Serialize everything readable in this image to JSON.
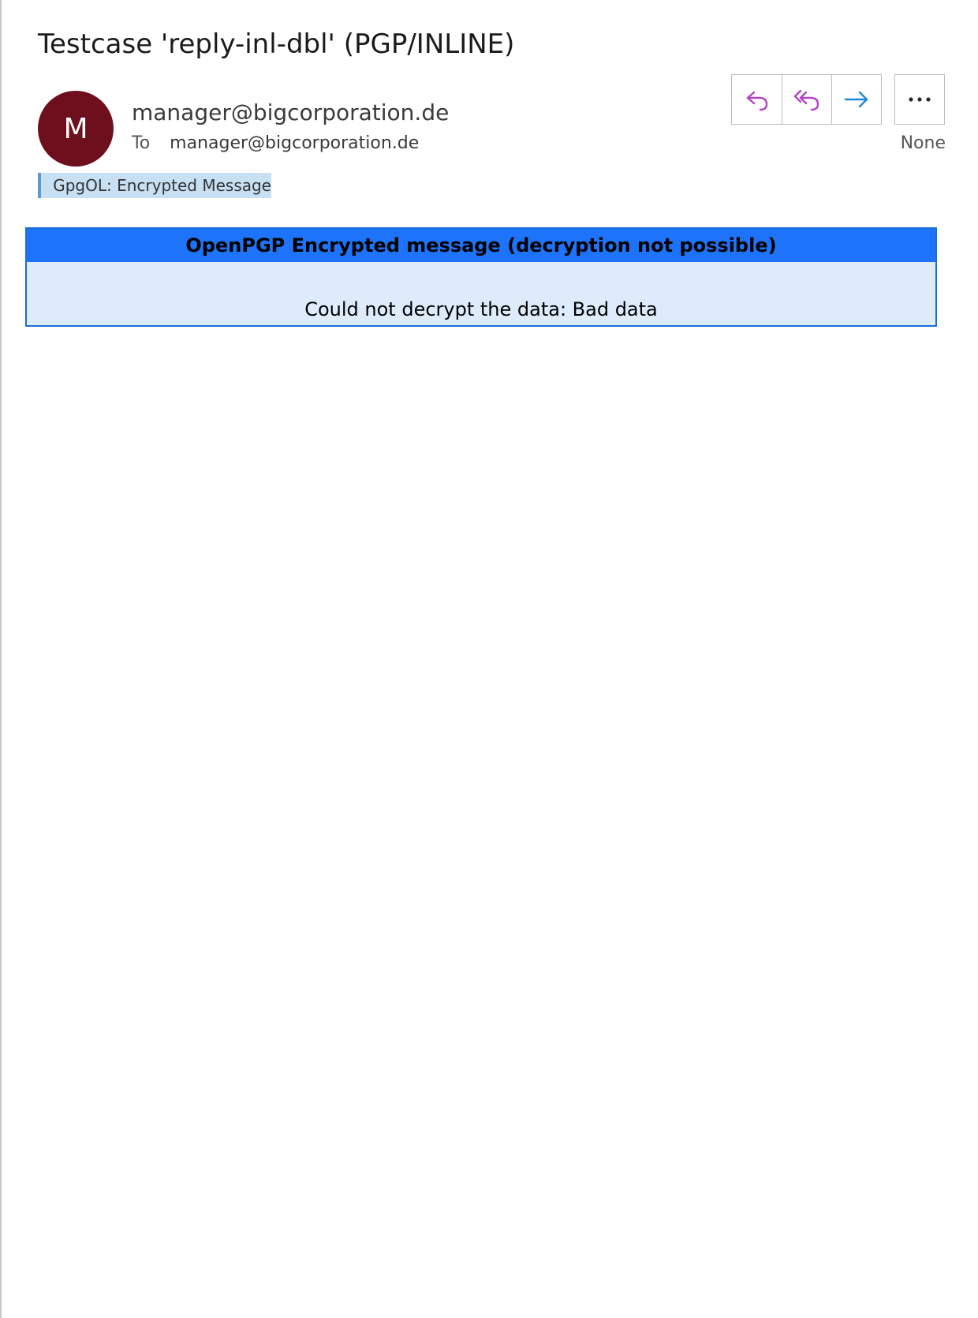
{
  "message": {
    "subject": "Testcase 'reply-inl-dbl' (PGP/INLINE)",
    "sender_initial": "M",
    "sender": "manager@bigcorporation.de",
    "to_label": "To",
    "to_address": "manager@bigcorporation.de",
    "date": "None",
    "category": "GpgOL: Encrypted Message"
  },
  "actions": {
    "reply_icon": "reply-icon",
    "reply_all_icon": "reply-all-icon",
    "forward_icon": "forward-icon",
    "more_icon": "more-icon"
  },
  "pgp_notice": {
    "title": "OpenPGP Encrypted message (decryption not possible)",
    "body": "Could not decrypt the data: Bad data"
  },
  "colors": {
    "avatar_bg": "#6e0f1e",
    "reply_icon": "#b146c2",
    "forward_icon": "#1e88d6",
    "category_bg": "#c7e0f4",
    "category_bar": "#5b9bd5",
    "notice_header": "#1e73fb",
    "notice_body": "#ddebfb"
  }
}
